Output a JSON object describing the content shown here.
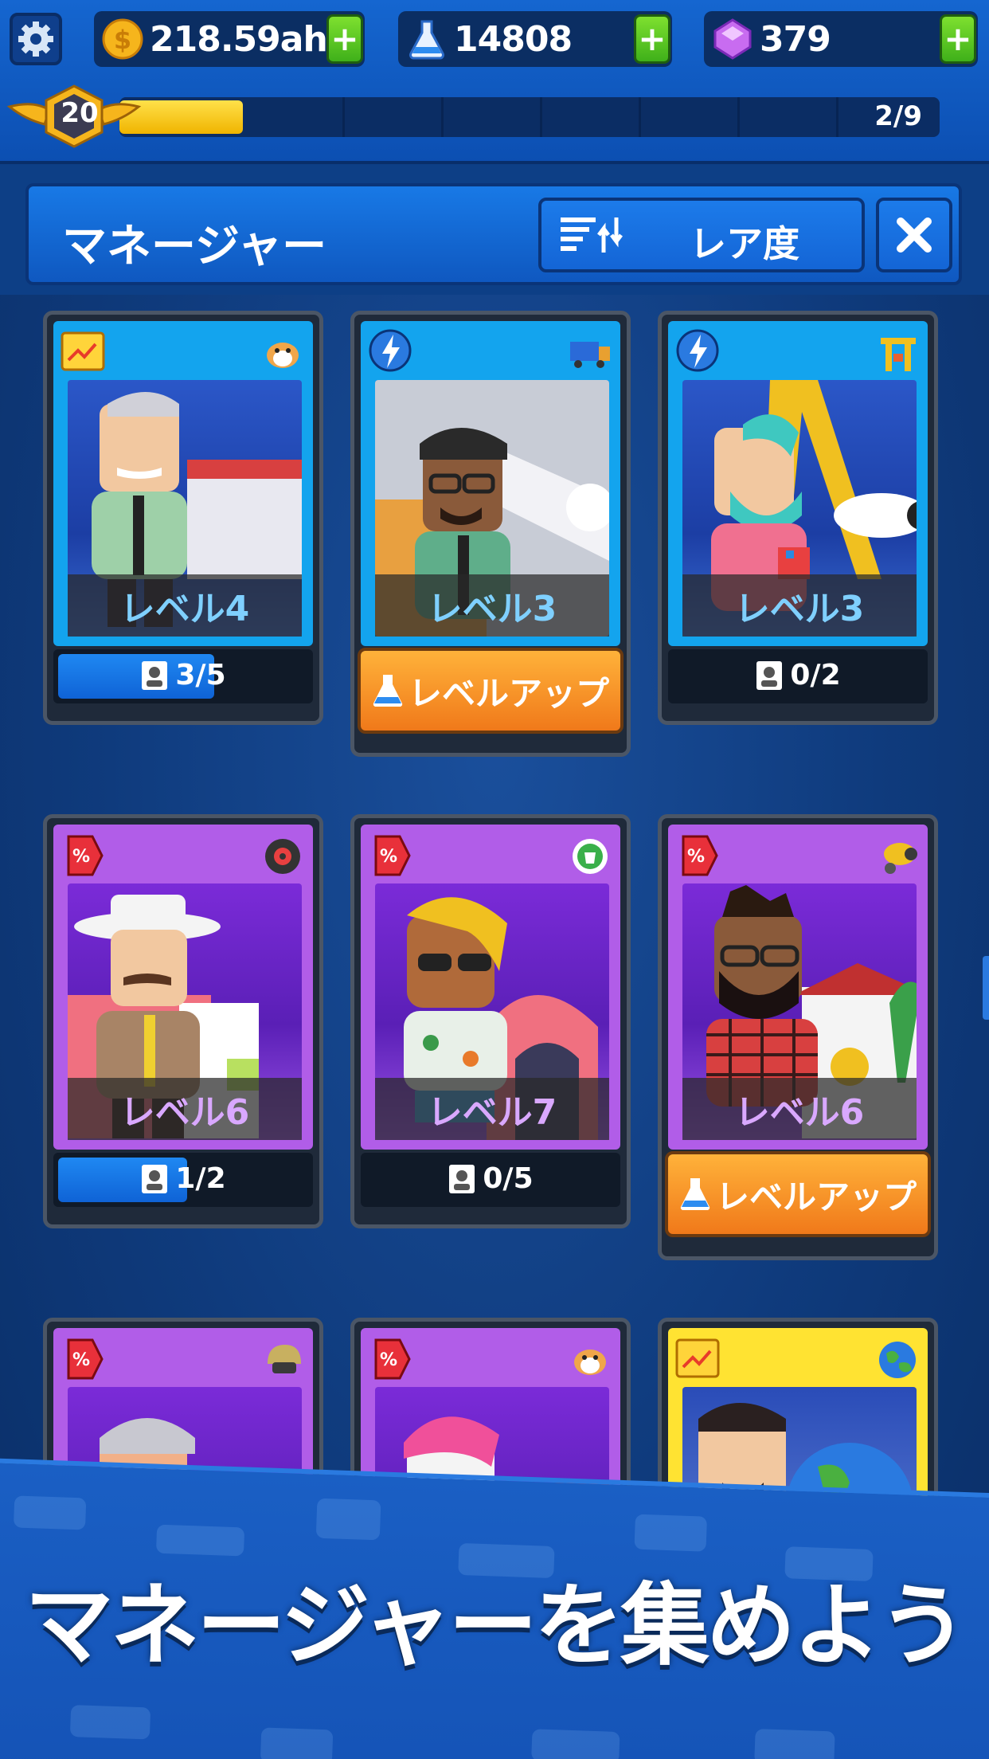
{
  "resources": {
    "coins": "218.59ah",
    "research": "14808",
    "gems": "379"
  },
  "player": {
    "level": "20",
    "progress_text": "2/9",
    "progress_fraction": 0.15
  },
  "panel": {
    "title": "マネージャー",
    "sort_label": "レア度"
  },
  "cards": [
    {
      "level": "レベル4",
      "footer": "3/5",
      "progress": 0.6,
      "frame": "blue",
      "skill": "chart-icon",
      "industry": "hamster-icon"
    },
    {
      "level": "レベル3",
      "button": "レベルアップ",
      "frame": "blue",
      "skill": "lightning-icon",
      "industry": "train-icon"
    },
    {
      "level": "レベル3",
      "footer": "0/2",
      "progress": 0,
      "frame": "blue",
      "skill": "lightning-icon",
      "industry": "crane-icon"
    },
    {
      "level": "レベル6",
      "footer": "1/2",
      "progress": 0.5,
      "frame": "purple",
      "skill": "discount-tag-icon",
      "industry": "tire-icon"
    },
    {
      "level": "レベル7",
      "footer": "0/5",
      "progress": 0,
      "frame": "purple",
      "skill": "discount-tag-icon",
      "industry": "recycle-bin-icon"
    },
    {
      "level": "レベル6",
      "button": "レベルアップ",
      "frame": "purple",
      "skill": "discount-tag-icon",
      "industry": "cannon-icon"
    },
    {
      "frame": "purple",
      "skill": "discount-tag-icon",
      "industry": "helmet-icon"
    },
    {
      "frame": "purple",
      "skill": "discount-tag-icon",
      "industry": "hamster-icon"
    },
    {
      "frame": "yellow",
      "skill": "chart-icon",
      "industry": "globe-icon"
    }
  ],
  "banner": {
    "text": "マネージャーを集めよう"
  },
  "colors": {
    "accent_blue": "#1566d0",
    "levelup_orange": "#f0791a",
    "plus_green": "#3fb01a"
  }
}
